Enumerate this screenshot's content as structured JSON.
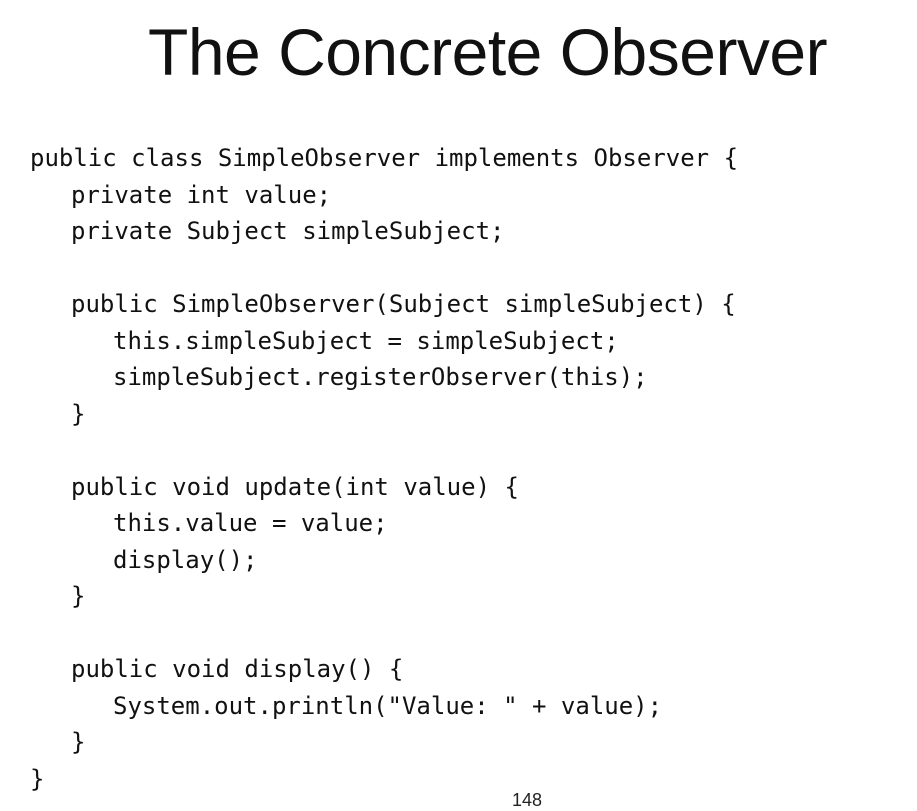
{
  "slide": {
    "title": "The Concrete Observer",
    "page_number": "148",
    "code_lines": [
      {
        "indent": 0,
        "text": "public class SimpleObserver implements Observer {"
      },
      {
        "indent": 1,
        "text": "private int value;"
      },
      {
        "indent": 1,
        "text": "private Subject simpleSubject;"
      },
      {
        "indent": 0,
        "text": ""
      },
      {
        "indent": 1,
        "text": "public SimpleObserver(Subject simpleSubject) {"
      },
      {
        "indent": 2,
        "text": "this.simpleSubject = simpleSubject;"
      },
      {
        "indent": 2,
        "text": "simpleSubject.registerObserver(this);"
      },
      {
        "indent": 1,
        "text": "}"
      },
      {
        "indent": 0,
        "text": ""
      },
      {
        "indent": 1,
        "text": "public void update(int value) {"
      },
      {
        "indent": 2,
        "text": "this.value = value;"
      },
      {
        "indent": 2,
        "text": "display();"
      },
      {
        "indent": 1,
        "text": "}"
      },
      {
        "indent": 0,
        "text": ""
      },
      {
        "indent": 1,
        "text": "public void display() {"
      },
      {
        "indent": 2,
        "text": "System.out.println(\"Value: \" + value);"
      },
      {
        "indent": 1,
        "text": "}"
      },
      {
        "indent": 0,
        "text": "}"
      }
    ]
  }
}
